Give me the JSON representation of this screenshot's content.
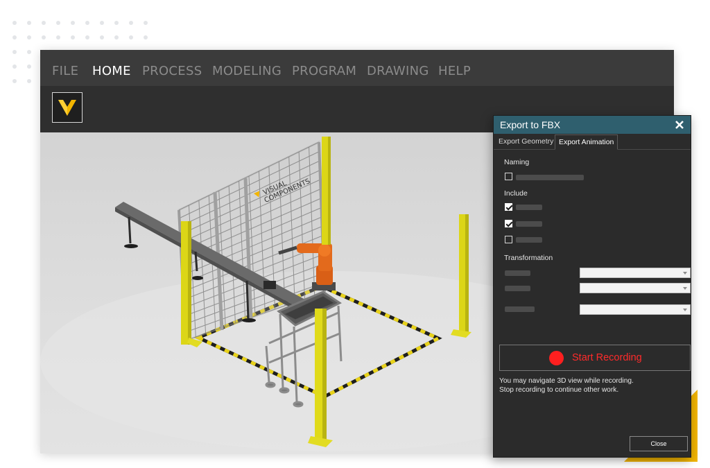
{
  "menu": {
    "items": [
      "FILE",
      "HOME",
      "PROCESS",
      "MODELING",
      "PROGRAM",
      "DRAWING",
      "HELP"
    ],
    "active": "HOME"
  },
  "scene": {
    "sign_line1": "VISUAL",
    "sign_line2": "COMPONENTS"
  },
  "dialog": {
    "title": "Export to FBX",
    "close_icon": "close-icon",
    "tabs": [
      "Export Geometry",
      "Export Animation"
    ],
    "active_tab": "Export Animation",
    "naming": {
      "label": "Naming",
      "option": {
        "checked": false,
        "label": "redacted"
      }
    },
    "include": {
      "label": "Include",
      "options": [
        {
          "checked": true,
          "label": "redacted"
        },
        {
          "checked": true,
          "label": "redacted"
        },
        {
          "checked": false,
          "label": "redacted"
        }
      ]
    },
    "transformation": {
      "label": "Transformation",
      "rows": [
        {
          "label": "redacted",
          "value": ""
        },
        {
          "label": "redacted",
          "value": ""
        },
        {
          "label": "redacted",
          "value": ""
        }
      ]
    },
    "record_button": "Start Recording",
    "note_line1": "You may navigate 3D view while recording.",
    "note_line2": "Stop recording to continue other work.",
    "close_button": "Close"
  },
  "colors": {
    "accent_teal": "#2f5f6e",
    "record_red": "#ff1f1f",
    "safety_yellow": "#e6e11a",
    "robot_orange": "#e36a1c",
    "logo_gold": "#f2b500"
  }
}
